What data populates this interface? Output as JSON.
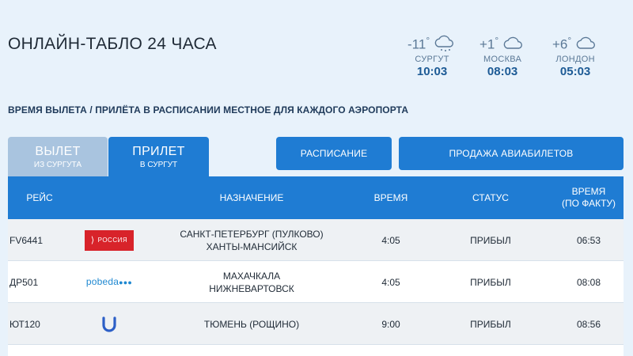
{
  "header": {
    "title": "ОНЛАЙН-ТАБЛО 24 ЧАСА",
    "note": "ВРЕМЯ ВЫЛЕТА / ПРИЛЁТА В РАСПИСАНИИ МЕСТНОЕ ДЛЯ КАЖДОГО АЭРОПОРТА"
  },
  "weather": [
    {
      "temp": "-11",
      "degree": "°",
      "city": "СУРГУТ",
      "time": "10:03",
      "icon": "snow-cloud-icon"
    },
    {
      "temp": "+1",
      "degree": "°",
      "city": "МОСКВА",
      "time": "08:03",
      "icon": "cloud-icon"
    },
    {
      "temp": "+6",
      "degree": "°",
      "city": "ЛОНДОН",
      "time": "05:03",
      "icon": "cloud-icon"
    }
  ],
  "tabs": {
    "departure": {
      "label": "ВЫЛЕТ",
      "sub": "ИЗ СУРГУТА"
    },
    "arrival": {
      "label": "ПРИЛЕТ",
      "sub": "В СУРГУТ"
    }
  },
  "buttons": {
    "schedule": "РАСПИСАНИЕ",
    "tickets": "ПРОДАЖА АВИАБИЛЕТОВ"
  },
  "table": {
    "headers": {
      "flight": "РЕЙС",
      "destination": "НАЗНАЧЕНИЕ",
      "time": "ВРЕМЯ",
      "status": "СТАТУС",
      "fact_line1": "ВРЕМЯ",
      "fact_line2": "(ПО ФАКТУ)"
    },
    "rows": [
      {
        "flight": "FV6441",
        "airline": "РОССИЯ",
        "dest1": "САНКТ-ПЕТЕРБУРГ (ПУЛКОВО)",
        "dest2": "ХАНТЫ-МАНСИЙСК",
        "time": "4:05",
        "status": "ПРИБЫЛ",
        "fact": "06:53"
      },
      {
        "flight": "ДР501",
        "airline": "pobeda",
        "dest1": "МАХАЧКАЛА",
        "dest2": "НИЖНЕВАРТОВСК",
        "time": "4:05",
        "status": "ПРИБЫЛ",
        "fact": "08:08"
      },
      {
        "flight": "ЮТ120",
        "airline": "",
        "dest1": "ТЮМЕНЬ (РОЩИНО)",
        "dest2": "",
        "time": "9:00",
        "status": "ПРИБЫЛ",
        "fact": "08:56"
      }
    ]
  },
  "colors": {
    "accent": "#1f7cd3",
    "tab_inactive": "#a9c4df",
    "background": "#e8f2fb",
    "rossiya_red": "#d8232a",
    "pobeda_blue": "#1e88d1",
    "utair_blue": "#2c5fc7"
  }
}
